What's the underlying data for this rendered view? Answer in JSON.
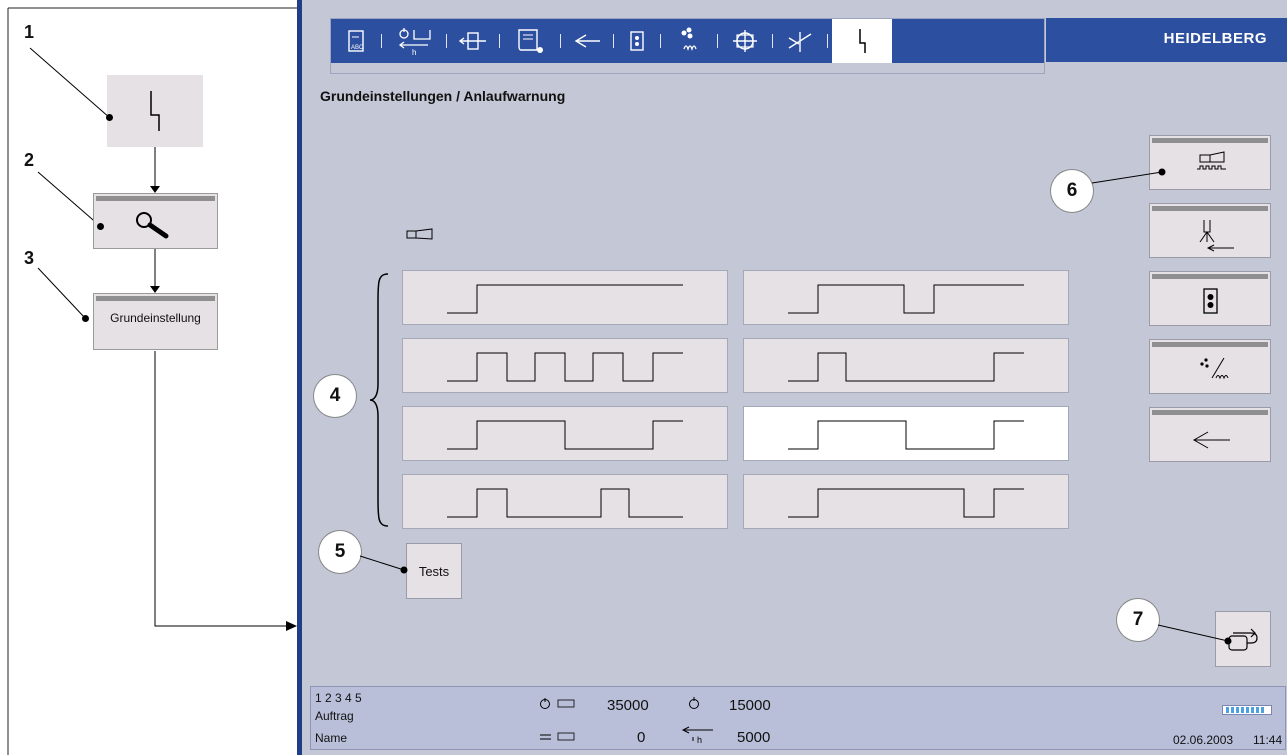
{
  "diagram": {
    "callouts": [
      "1",
      "2",
      "3",
      "4",
      "5",
      "6",
      "7"
    ],
    "step3_label": "Grundeinstellung"
  },
  "brand": "HEIDELBERG",
  "toolbar": {
    "tabs": [
      {
        "icon": "abc-document-icon",
        "sub": "ABC"
      },
      {
        "icon": "feed-pile-icon",
        "sub": "h"
      },
      {
        "icon": "register-icon"
      },
      {
        "icon": "paper-roll-icon"
      },
      {
        "icon": "arrow-left-icon"
      },
      {
        "icon": "ink-unit-icon"
      },
      {
        "icon": "dampening-icon"
      },
      {
        "icon": "crosshair-register-icon"
      },
      {
        "icon": "spray-powder-icon"
      },
      {
        "icon": "start-warning-icon",
        "active": true
      }
    ]
  },
  "page_title": "Grundeinstellungen / Anlaufwarnung",
  "horn_icon": "horn-icon",
  "signal_patterns": {
    "selected_index": 5,
    "items": [
      "pattern-1",
      "pattern-2",
      "pattern-3",
      "pattern-4",
      "pattern-5",
      "pattern-6",
      "pattern-7",
      "pattern-8"
    ]
  },
  "side_buttons": [
    {
      "icon": "horn-pulse-icon",
      "selected": true
    },
    {
      "icon": "spray-dryer-icon"
    },
    {
      "icon": "ink-unit-icon"
    },
    {
      "icon": "powder-dampening-icon"
    },
    {
      "icon": "arrow-left-icon"
    }
  ],
  "tests_label": "Tests",
  "status": {
    "units": "1 2 3 4 5",
    "auftrag_label": "Auftrag",
    "name_label": "Name",
    "counter1_value": "35000",
    "speed_value": "15000",
    "counter2_value": "0",
    "hours_value": "5000",
    "date": "02.06.2003",
    "time": "11:44"
  },
  "colors": {
    "screen_bg": "#c4c7d6",
    "tab_blue": "#2d4f9f",
    "button_bg": "#e6e1e4",
    "status_bg": "#b9bfd9"
  }
}
